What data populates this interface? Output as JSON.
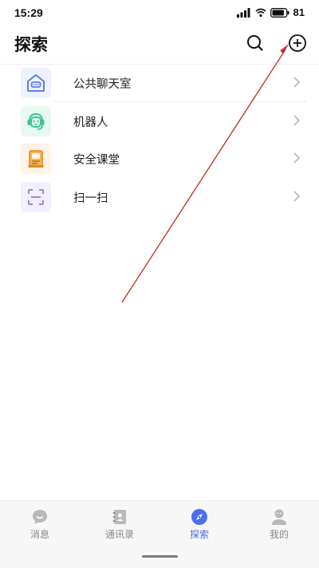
{
  "status_bar": {
    "time": "15:29",
    "battery": "81"
  },
  "header": {
    "title": "探索"
  },
  "list": {
    "items": [
      {
        "label": "公共聊天室",
        "icon": "chat-room-icon"
      },
      {
        "label": "机器人",
        "icon": "robot-icon"
      },
      {
        "label": "安全课堂",
        "icon": "security-class-icon"
      },
      {
        "label": "扫一扫",
        "icon": "scan-icon"
      }
    ]
  },
  "bottom_nav": {
    "tabs": [
      {
        "label": "消息",
        "icon": "message-icon",
        "active": false
      },
      {
        "label": "通讯录",
        "icon": "contacts-icon",
        "active": false
      },
      {
        "label": "探索",
        "icon": "compass-icon",
        "active": true
      },
      {
        "label": "我的",
        "icon": "profile-icon",
        "active": false
      }
    ]
  },
  "colors": {
    "accent": "#4a6ff0",
    "annotation_arrow": "#c0392b",
    "inactive_tab": "#888888",
    "robot_green": "#3ec29a",
    "class_orange": "#f39a2e",
    "scan_purple": "#9c86e0"
  }
}
